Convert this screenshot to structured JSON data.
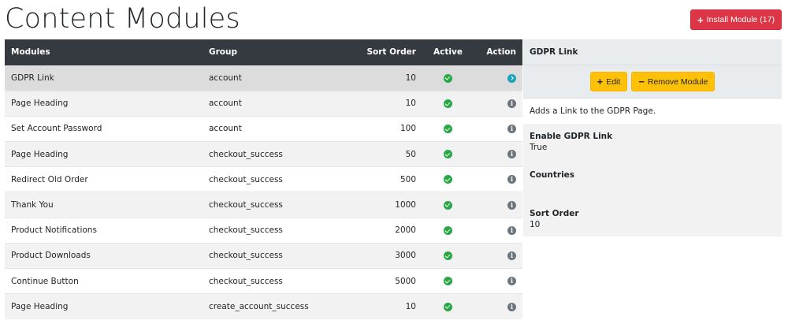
{
  "page": {
    "title": "Content Modules"
  },
  "install_button": {
    "label": "Install Module (17)"
  },
  "table": {
    "headers": {
      "modules": "Modules",
      "group": "Group",
      "sort_order": "Sort Order",
      "active": "Active",
      "action": "Action"
    },
    "rows": [
      {
        "name": "GDPR Link",
        "group": "account",
        "sort": "10",
        "active": true,
        "action_icon": "arrow-right-icon",
        "selected": true
      },
      {
        "name": "Page Heading",
        "group": "account",
        "sort": "10",
        "active": true,
        "action_icon": "info-icon"
      },
      {
        "name": "Set Account Password",
        "group": "account",
        "sort": "100",
        "active": true,
        "action_icon": "info-icon"
      },
      {
        "name": "Page Heading",
        "group": "checkout_success",
        "sort": "50",
        "active": true,
        "action_icon": "info-icon"
      },
      {
        "name": "Redirect Old Order",
        "group": "checkout_success",
        "sort": "500",
        "active": true,
        "action_icon": "info-icon"
      },
      {
        "name": "Thank You",
        "group": "checkout_success",
        "sort": "1000",
        "active": true,
        "action_icon": "info-icon"
      },
      {
        "name": "Product Notifications",
        "group": "checkout_success",
        "sort": "2000",
        "active": true,
        "action_icon": "info-icon"
      },
      {
        "name": "Product Downloads",
        "group": "checkout_success",
        "sort": "3000",
        "active": true,
        "action_icon": "info-icon"
      },
      {
        "name": "Continue Button",
        "group": "checkout_success",
        "sort": "5000",
        "active": true,
        "action_icon": "info-icon"
      },
      {
        "name": "Page Heading",
        "group": "create_account_success",
        "sort": "10",
        "active": true,
        "action_icon": "info-icon"
      }
    ]
  },
  "panel": {
    "title": "GDPR Link",
    "edit_label": "Edit",
    "remove_label": "Remove Module",
    "description": "Adds a Link to the GDPR Page.",
    "fields": [
      {
        "label": "Enable GDPR Link",
        "value": "True"
      },
      {
        "label": "Countries",
        "value": ""
      },
      {
        "label": "Sort Order",
        "value": "10"
      }
    ]
  },
  "colors": {
    "header_dark": "#343a40",
    "danger": "#dc3545",
    "warning": "#ffc107",
    "success": "#28a745",
    "info": "#17a2b8",
    "secondary": "#6c757d"
  }
}
